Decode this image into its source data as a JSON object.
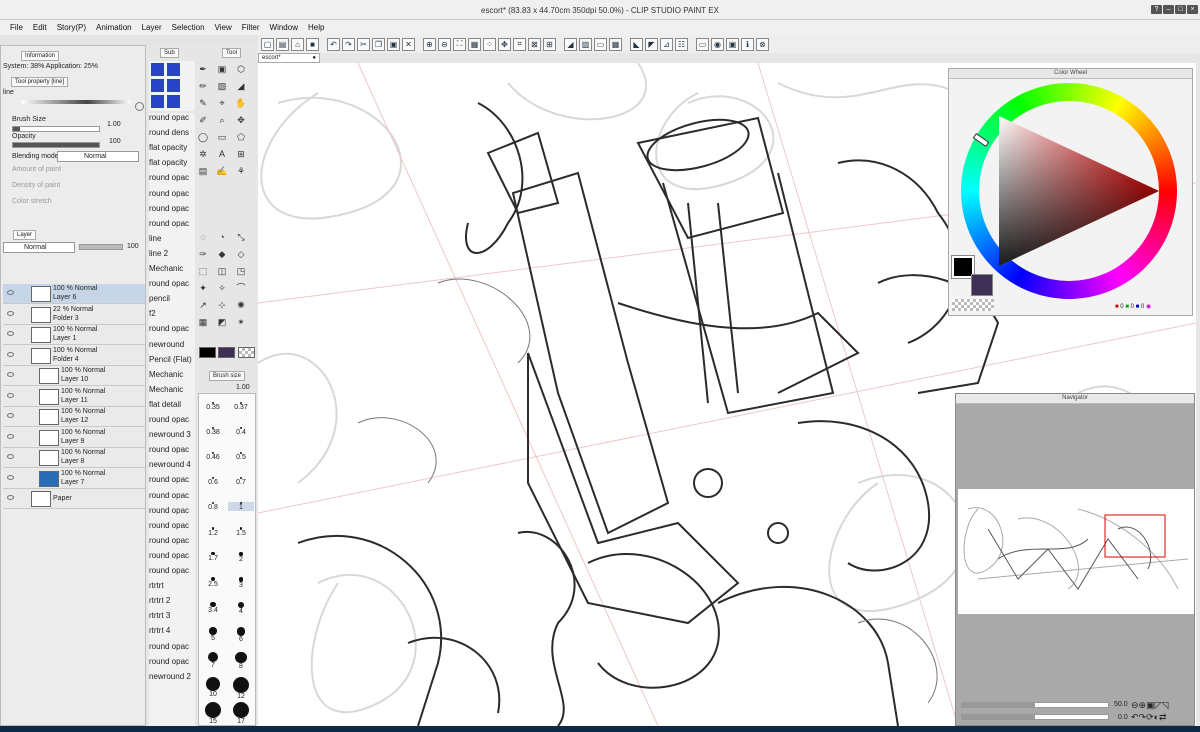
{
  "title": "escort* (83.83 x 44.70cm 350dpi 50.0%) - CLIP STUDIO PAINT EX",
  "menu": [
    "File",
    "Edit",
    "Story(P)",
    "Animation",
    "Layer",
    "Selection",
    "View",
    "Filter",
    "Window",
    "Help"
  ],
  "info": {
    "tab": "Information",
    "text": "System: 38%  Application: 25%"
  },
  "toolprop": {
    "tab": "Tool property [line]",
    "name": "line",
    "brush_size_label": "Brush Size",
    "brush_size": "1.00",
    "opacity_label": "Opacity",
    "opacity": "100",
    "blending_label": "Blending mode",
    "blending": "Normal",
    "amount_label": "Amount of paint",
    "density_label": "Density of paint",
    "stretch_label": "Color stretch"
  },
  "layer_panel": {
    "tab": "Layer",
    "mode": "Normal",
    "opacity": "100"
  },
  "layers": [
    {
      "p": "100 % Normal",
      "n": "Layer 6",
      "sel": true
    },
    {
      "p": "22 % Normal",
      "n": "Folder 3"
    },
    {
      "p": "100 % Normal",
      "n": "Layer 1"
    },
    {
      "p": "100 % Normal",
      "n": "Folder 4"
    },
    {
      "p": "100 % Normal",
      "n": "Layer 10"
    },
    {
      "p": "100 % Normal",
      "n": "Layer 11"
    },
    {
      "p": "100 % Normal",
      "n": "Layer 12"
    },
    {
      "p": "100 % Normal",
      "n": "Layer 9"
    },
    {
      "p": "100 % Normal",
      "n": "Layer 8"
    },
    {
      "p": "100 % Normal",
      "n": "Layer 7"
    },
    {
      "p": "",
      "n": "Paper"
    }
  ],
  "sub_tool": {
    "tab": "Sub",
    "tool_tab": "Tool"
  },
  "sub_tools": [
    "round opac",
    "round dens",
    "flat opacity",
    "flat opacity",
    "round opac",
    "round opac",
    "round opac",
    "round opac",
    "line",
    "line 2",
    "Mechanic",
    "round opac",
    "pencil",
    "f2",
    "round opac",
    "newround",
    "Pencil (Flat)",
    "Mechanic",
    "Mechanic",
    "flat detail",
    "round opac",
    "newround 3",
    "round opac",
    "newround 4",
    "round opac",
    "round opac",
    "round opac",
    "round opac",
    "round opac",
    "round opac",
    "round opac",
    "rtrtrt",
    "rtrtrt 2",
    "rtrtrt 3",
    "rtrtrt 4",
    "round opac",
    "round opac",
    "newround 2"
  ],
  "brush_size": {
    "tab": "Brush size",
    "value": "1.00",
    "sizes": [
      "0.35",
      "0.37",
      "0.38",
      "0.4",
      "0.46",
      "0.5",
      "0.6",
      "0.7",
      "0.8",
      "1",
      "1.2",
      "1.5",
      "1.7",
      "2",
      "2.5",
      "3",
      "3.4",
      "4",
      "5",
      "6",
      "7",
      "8",
      "10",
      "12",
      "15",
      "17"
    ]
  },
  "doc_tab": "escort*",
  "color_wheel": {
    "title": "Color Wheel",
    "r": "0",
    "g": "0",
    "b": "0"
  },
  "navigator": {
    "title": "Navigator",
    "zoom": "50.0",
    "rotate": "0.0"
  }
}
